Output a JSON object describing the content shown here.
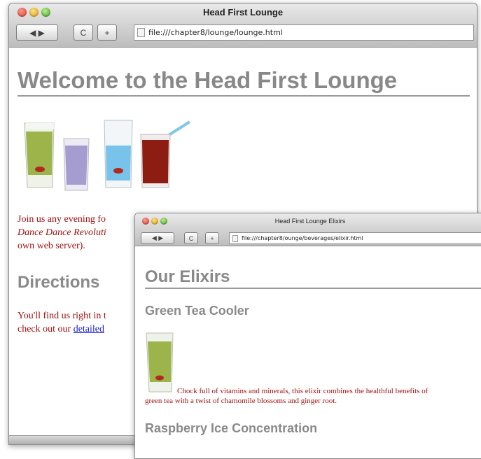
{
  "lounge": {
    "window_title": "Head First Lounge",
    "url": "file:///chapter8/lounge/lounge.html",
    "heading": "Welcome to the Head First Lounge",
    "intro_line1": "Join us any evening fo",
    "intro_line2": "Dance Dance Revoluti",
    "intro_line3": "own web server).",
    "directions_heading": "Directions",
    "directions_line1": "You'll find us right in t",
    "directions_line2_prefix": "check out our ",
    "directions_link": "detailed"
  },
  "elixirs": {
    "window_title": "Head First Lounge Elixirs",
    "url": "file:///chapter8/ounge/beverages/elixir.html",
    "heading": "Our Elixirs",
    "green_tea_heading": "Green Tea Cooler",
    "green_tea_desc_line1": "Chock full of vitamins and minerals, this elixir combines the healthful benefits of",
    "green_tea_desc_line2": "green tea with a twist of chamomile blossoms and ginger root.",
    "raspberry_heading": "Raspberry Ice Concentration"
  },
  "toolbar": {
    "back_forward": "◀ ▶",
    "reload": "C",
    "add": "+"
  },
  "colors": {
    "heading_gray": "#888888",
    "body_text_red": "#a11010",
    "link_blue": "#1d1de0"
  }
}
